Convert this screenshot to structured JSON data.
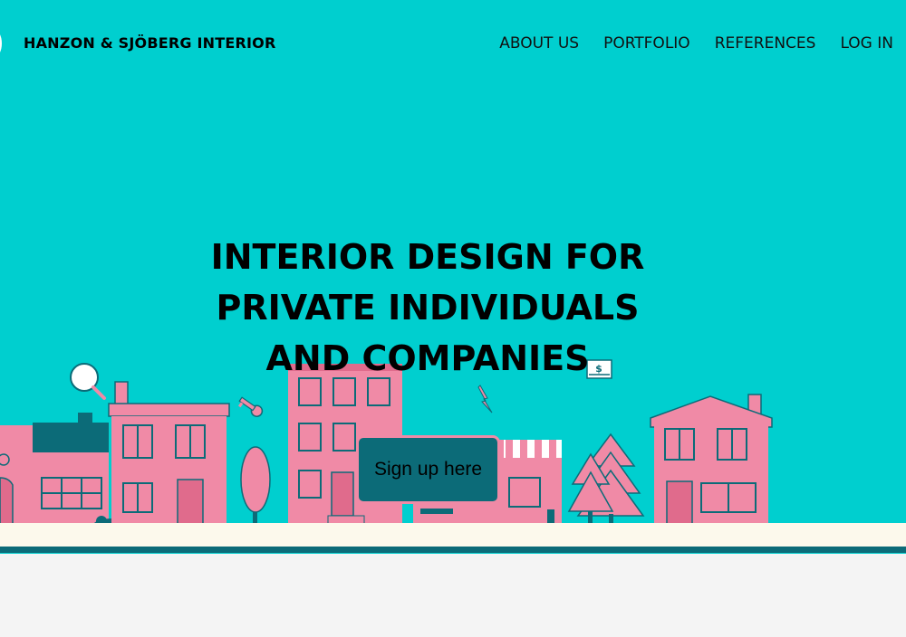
{
  "header": {
    "brand": "HANZON & SJÖBERG INTERIOR",
    "nav": [
      "ABOUT US",
      "PORTFOLIO",
      "REFERENCES",
      "LOG IN"
    ]
  },
  "hero": {
    "headline_lines": [
      "INTERIOR DESIGN FOR",
      "PRIVATE INDIVIDUALS",
      "AND COMPANIES"
    ],
    "cta_label": "Sign up here",
    "money_symbol": "$"
  },
  "colors": {
    "hero_bg": "#00cfcf",
    "house_pink": "#f08aa6",
    "dark_teal": "#0c6b78",
    "ground": "#fcf9ec"
  },
  "icons": [
    "magnifier-icon",
    "key-icon",
    "lightning-icon",
    "dollar-bill-icon"
  ]
}
